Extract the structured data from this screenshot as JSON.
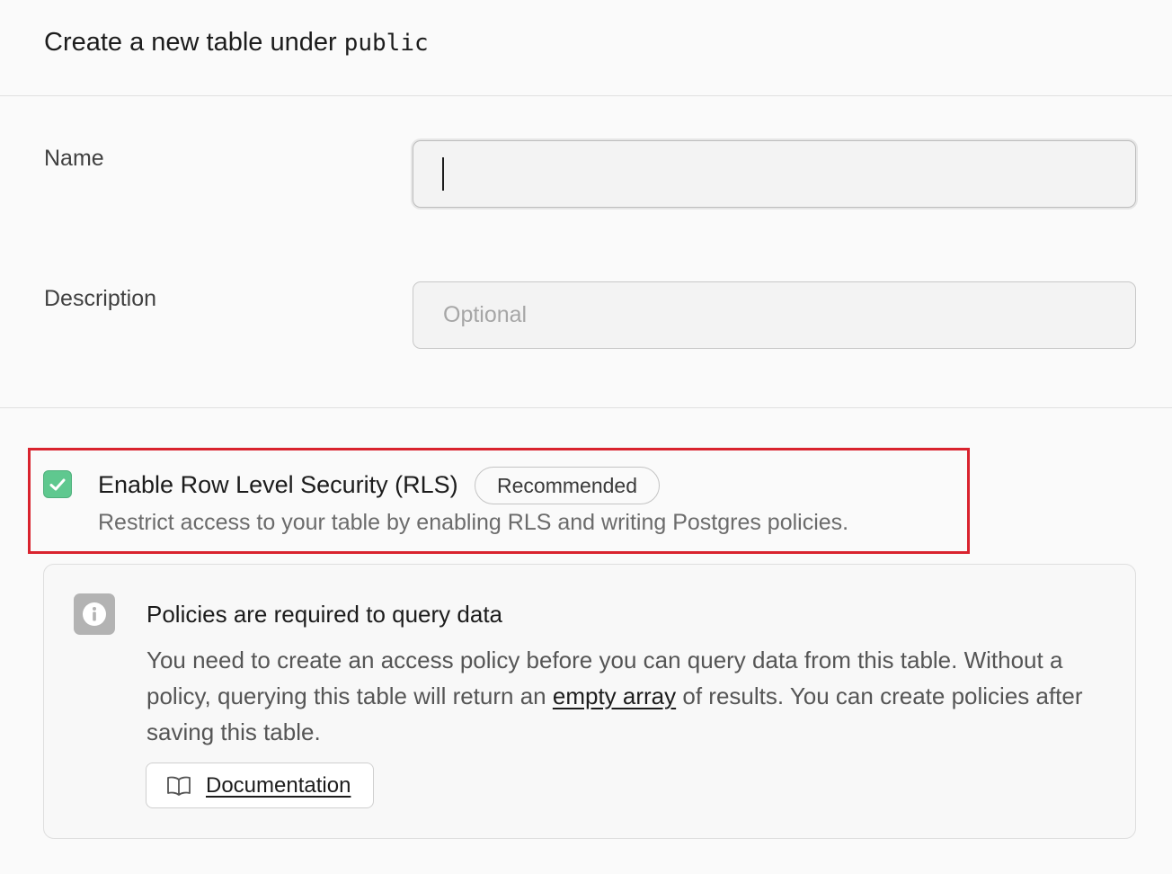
{
  "header": {
    "title": "Create a new table under",
    "schema": "public"
  },
  "form": {
    "name_label": "Name",
    "name_value": "",
    "description_label": "Description",
    "description_placeholder": "Optional"
  },
  "rls": {
    "checked": true,
    "label": "Enable Row Level Security (RLS)",
    "badge": "Recommended",
    "description": "Restrict access to your table by enabling RLS and writing Postgres policies."
  },
  "alert": {
    "icon": "info-icon",
    "title": "Policies are required to query data",
    "body_part1": "You need to create an access policy before you can query data from this table. Without a policy, querying this table will return an",
    "body_link": "empty array",
    "body_part2": "of results. You can create policies after saving this table.",
    "doc_button": "Documentation",
    "doc_icon": "book-icon"
  },
  "colors": {
    "checkbox_green": "#5fc88f",
    "highlight_red": "#d9232e"
  }
}
